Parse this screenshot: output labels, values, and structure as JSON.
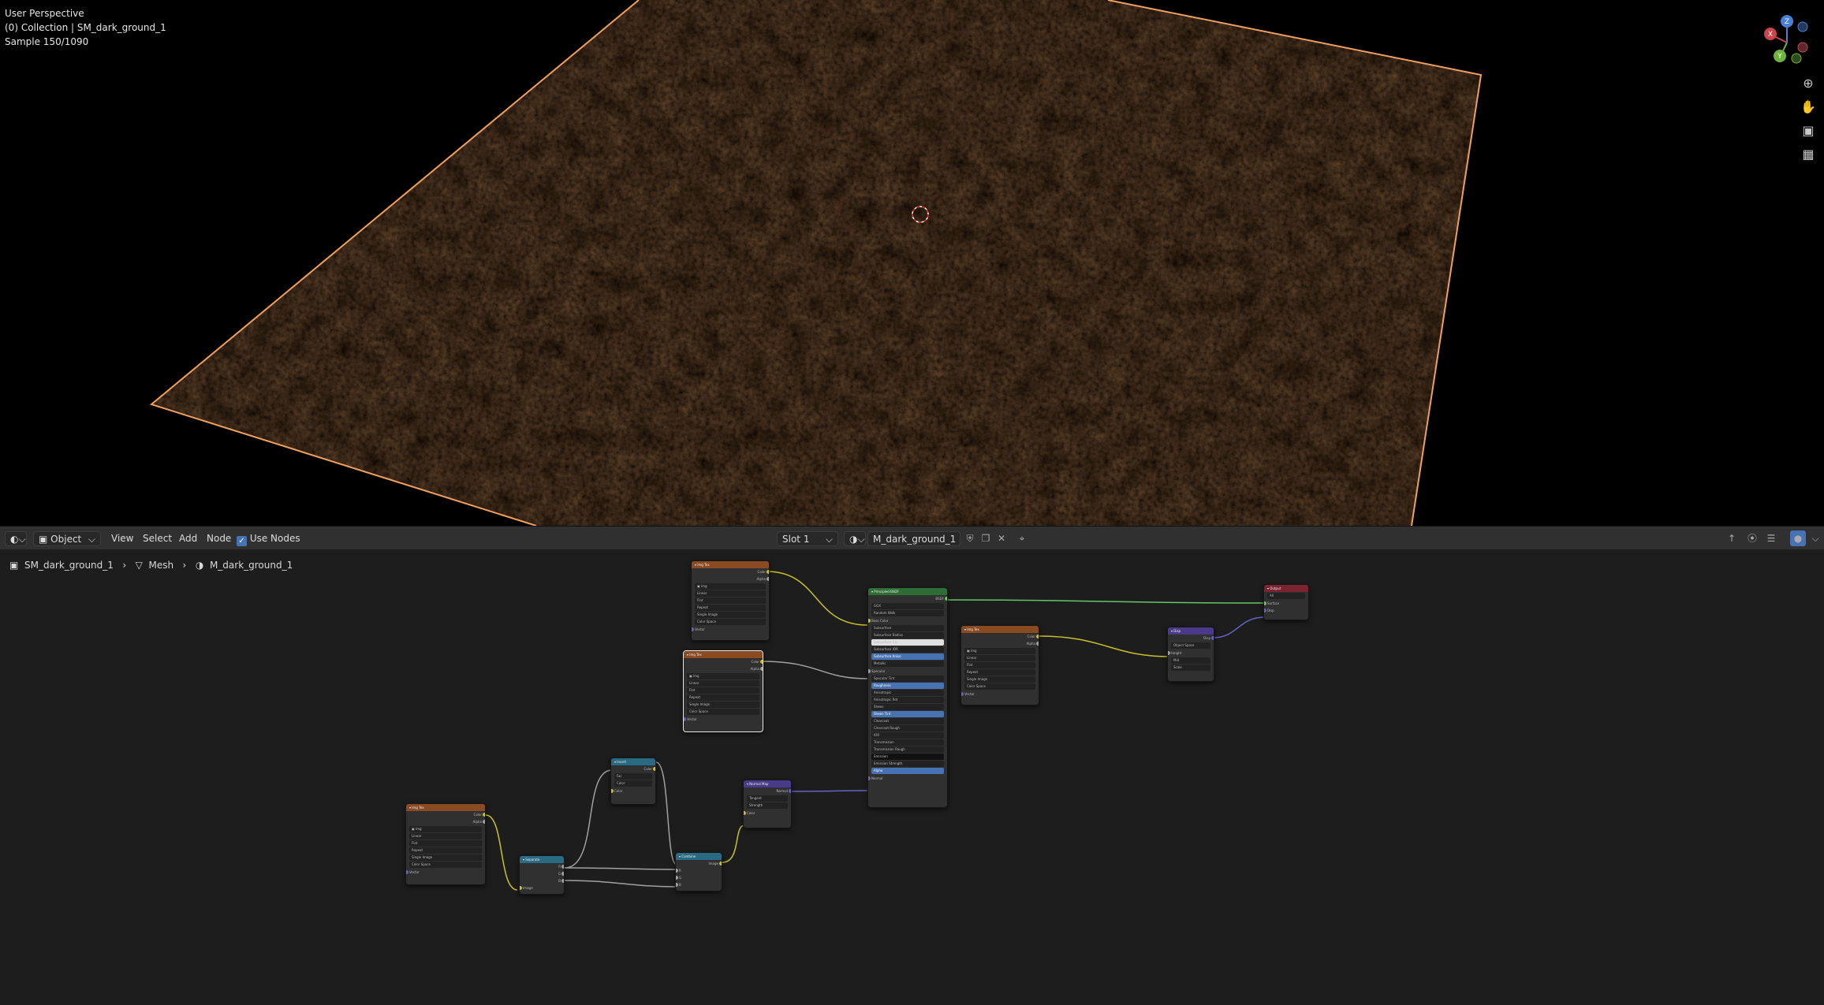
{
  "viewport": {
    "perspective": "User Perspective",
    "collection": "(0) Collection | SM_dark_ground_1",
    "samples": "Sample 150/1090"
  },
  "viewport_icons": [
    "zoom-icon",
    "hand-pan-icon",
    "camera-icon",
    "grid-icon"
  ],
  "axis_gizmo": {
    "x": "X",
    "y": "Y",
    "z": "Z"
  },
  "header": {
    "editor_icon": "node-editor-icon",
    "mode": "Object",
    "menus": [
      "View",
      "Select",
      "Add",
      "Node"
    ],
    "use_nodes_label": "Use Nodes",
    "use_nodes_checked": true,
    "slot": "Slot 1",
    "material_name": "M_dark_ground_1"
  },
  "breadcrumb": {
    "object": "SM_dark_ground_1",
    "mesh": "Mesh",
    "material": "M_dark_ground_1"
  },
  "colors": {
    "selection_outline": "#f0a060",
    "wire_color": "#c7c229",
    "wire_gray": "#a0a0a0",
    "wire_vector": "#6363c7",
    "wire_shader": "#63c763",
    "accent_blue": "#4772b3"
  }
}
